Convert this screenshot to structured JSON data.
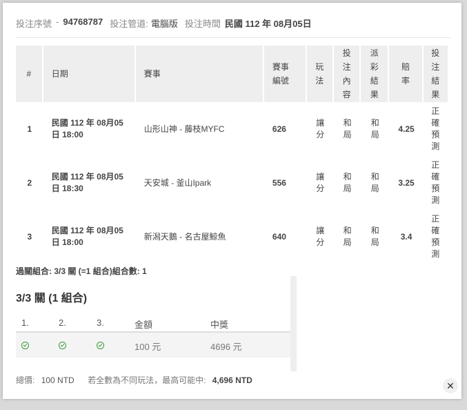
{
  "header": {
    "serial_label": "投注序號",
    "separator": "-",
    "serial_value": "94768787",
    "channel_label": "投注管道:",
    "channel_value": "電腦版",
    "time_label": "投注時間",
    "time_value": "民國 112 年 08月05日"
  },
  "table": {
    "headers": [
      "#",
      "日期",
      "賽事",
      "賽事編號",
      "玩法",
      "投注內容",
      "派彩結果",
      "賠率",
      "投注結果"
    ],
    "rows": [
      {
        "num": "1",
        "date": "民國 112 年 08月05日 18:00",
        "match": "山形山神 - 藤枝MYFC",
        "match_id": "626",
        "play": "讓分",
        "content": "和局",
        "payout": "和局",
        "odds": "4.25",
        "result": "正確預測"
      },
      {
        "num": "2",
        "date": "民國 112 年 08月05日 18:30",
        "match": "天安城 - 釜山Ipark",
        "match_id": "556",
        "play": "讓分",
        "content": "和局",
        "payout": "和局",
        "odds": "3.25",
        "result": "正確預測"
      },
      {
        "num": "3",
        "date": "民國 112 年 08月05日 18:00",
        "match": "新潟天鵝 - 名古屋鯨魚",
        "match_id": "640",
        "play": "讓分",
        "content": "和局",
        "payout": "和局",
        "odds": "3.4",
        "result": "正確預測"
      }
    ]
  },
  "combo_summary": "過關組合: 3/3 關 (=1 組合)組合數: 1",
  "combo_panel": {
    "title": "3/3 關 (1 組合)",
    "headers": [
      "1.",
      "2.",
      "3.",
      "金額",
      "中獎"
    ],
    "row": {
      "amount": "100 元",
      "win": "4696 元"
    }
  },
  "footer": {
    "total_label": "總價:",
    "total_value": "100 NTD",
    "max_label": "若全數為不同玩法，最高可能中:",
    "max_value": "4,696 NTD"
  },
  "close_glyph": "✕"
}
